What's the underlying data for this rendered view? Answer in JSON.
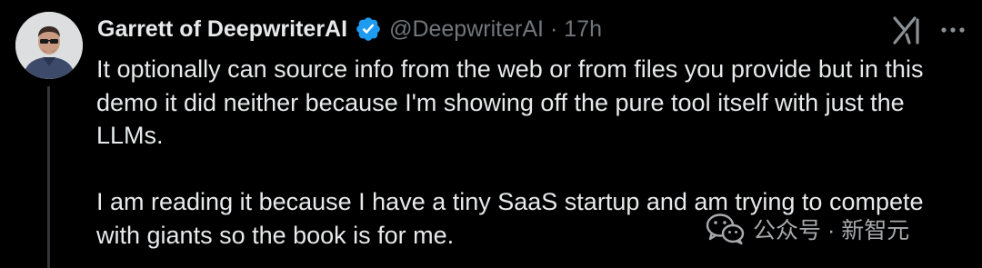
{
  "tweet": {
    "author": {
      "display_name": "Garrett of DeepwriterAI",
      "handle": "@DeepwriterAI",
      "verified": true
    },
    "separator": "·",
    "time": "17h",
    "paragraphs": [
      "It optionally can source info from the web or from files you provide but in this demo it did neither because I'm showing off the pure tool itself with just the LLMs.",
      "I am reading it because I have a tiny SaaS startup and am trying to compete with giants so the book is for me."
    ]
  },
  "watermark": {
    "text": "公众号 · 新智元",
    "icon": "wechat-icon"
  },
  "icons": {
    "verified": "verified-badge-icon",
    "grok": "grok-icon",
    "more": "more-options-icon"
  },
  "colors": {
    "background": "#000000",
    "text": "#e7e9ea",
    "secondary_text": "#71767b",
    "verified_blue": "#1d9bf0",
    "thread_line": "#333639"
  }
}
